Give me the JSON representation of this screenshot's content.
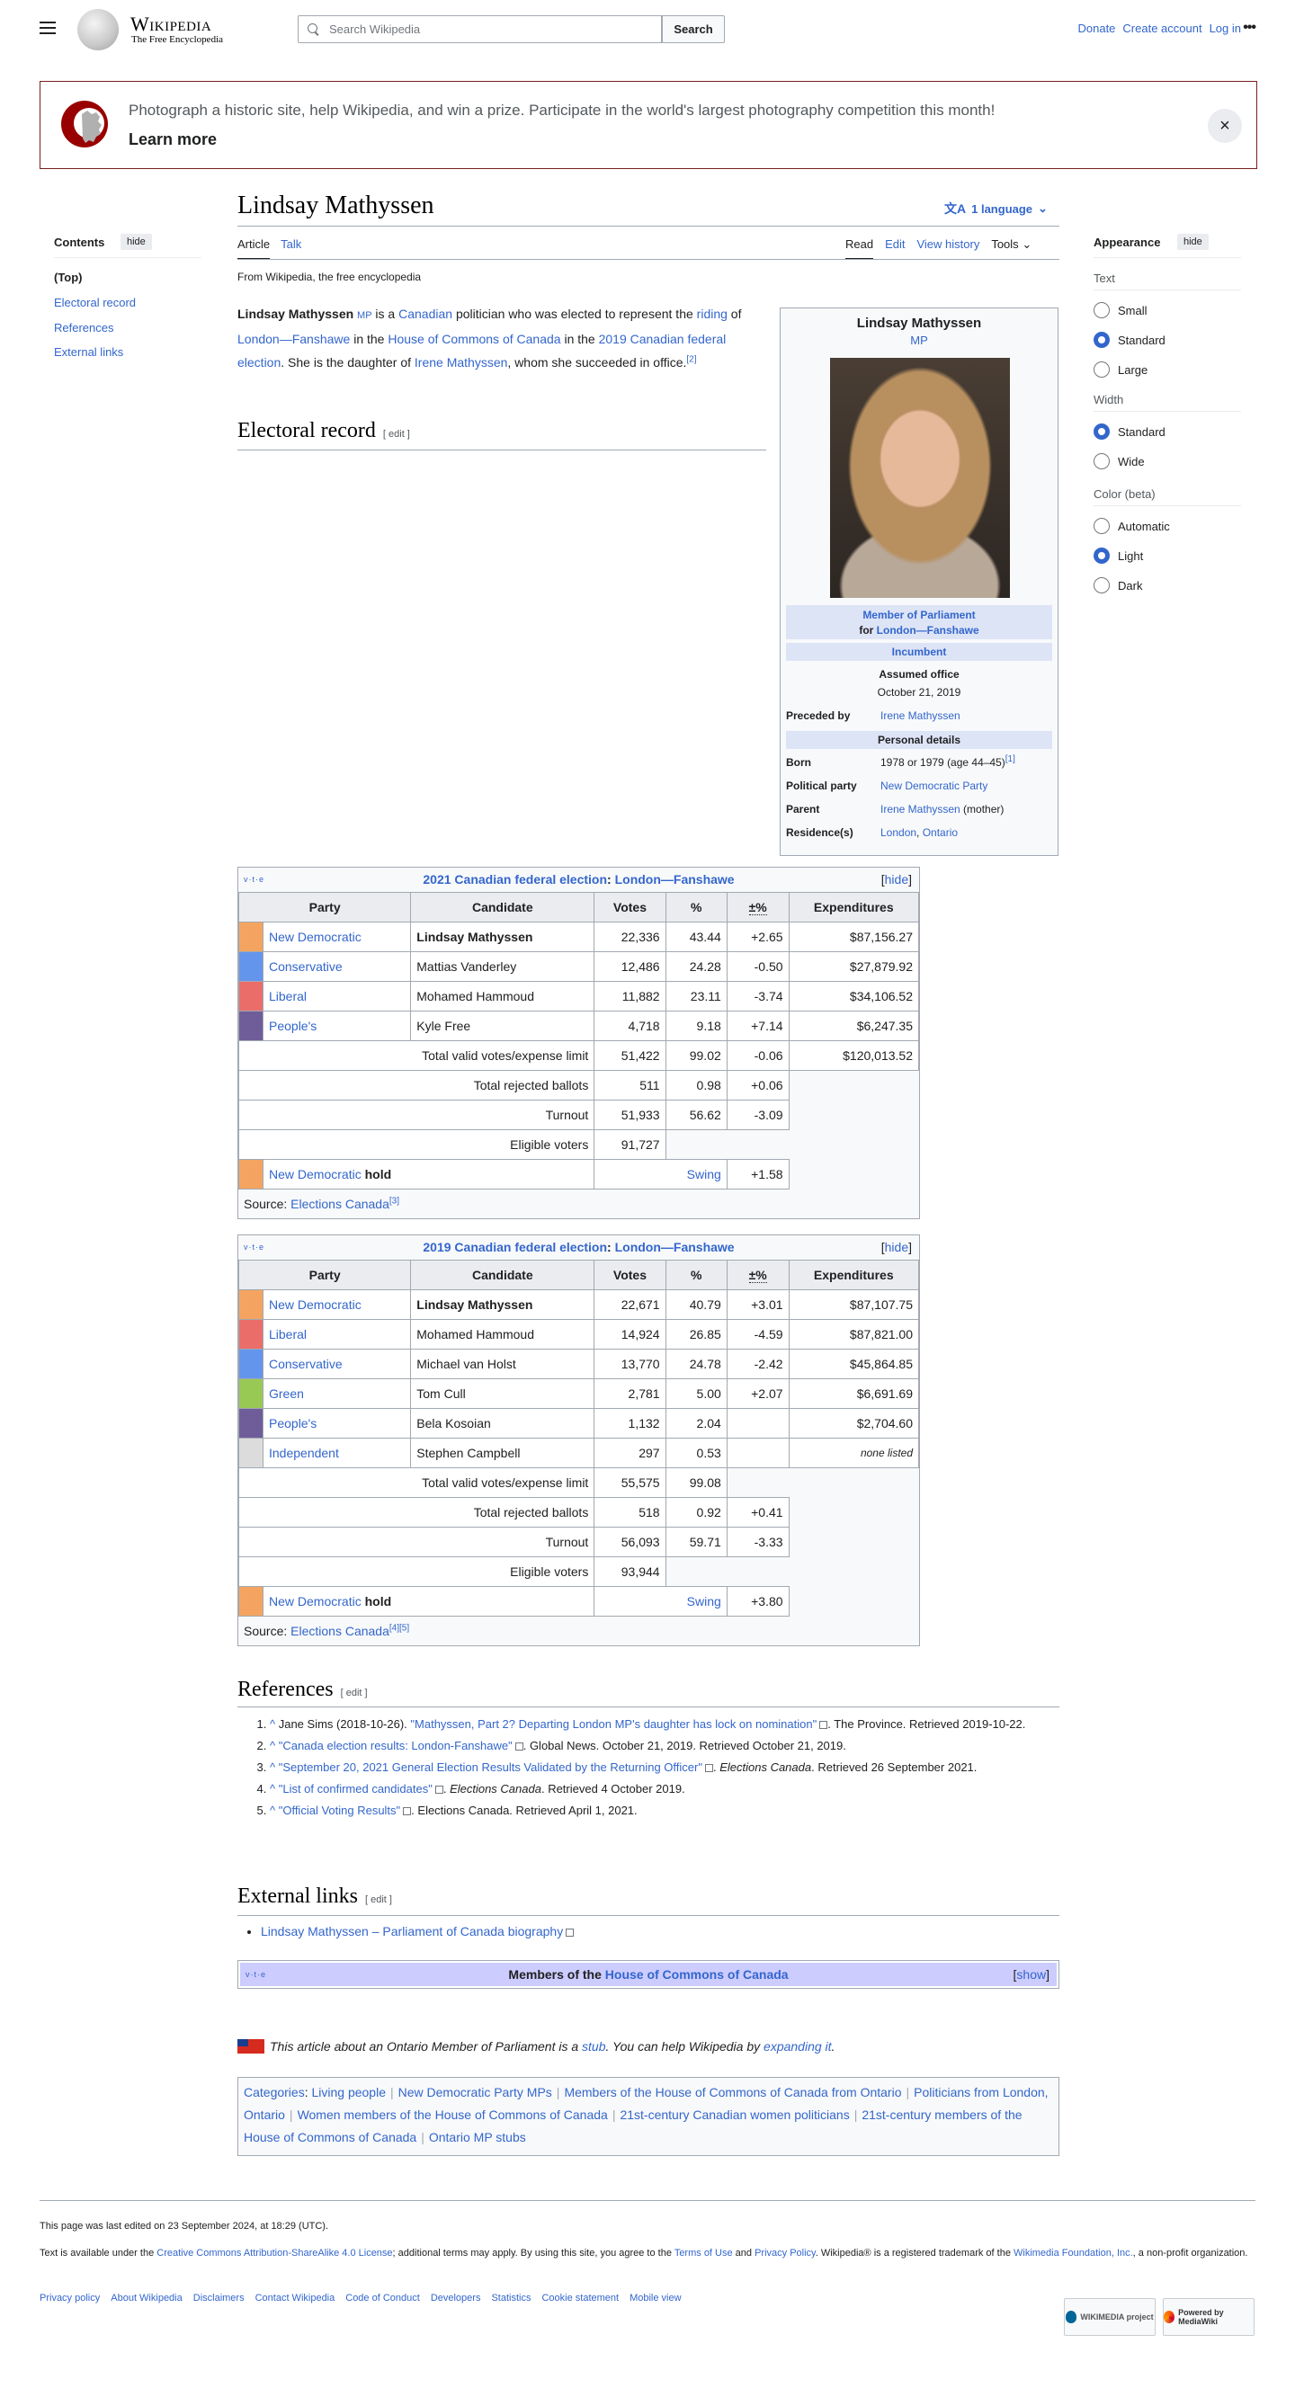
{
  "header": {
    "logo_word": "Wikipedia",
    "logo_tagline": "The Free Encyclopedia",
    "search_placeholder": "Search Wikipedia",
    "search_button": "Search",
    "links": [
      "Donate",
      "Create account",
      "Log in"
    ],
    "more": "•••"
  },
  "banner": {
    "text": "Photograph a historic site, help Wikipedia, and win a prize. Participate in the world's largest photography competition this month!",
    "learn_more": "Learn more",
    "close": "×"
  },
  "toc": {
    "title": "Contents",
    "hide": "hide",
    "items": [
      "(Top)",
      "Electoral record",
      "References",
      "External links"
    ]
  },
  "article": {
    "title": "Lindsay Mathyssen",
    "language_button": "1 language",
    "tabs_left": [
      "Article",
      "Talk"
    ],
    "tabs_right": [
      "Read",
      "Edit",
      "View history",
      "Tools"
    ],
    "from": "From Wikipedia, the free encyclopedia",
    "lead": {
      "name": "Lindsay Mathyssen",
      "mp": "MP",
      "t1": " is a ",
      "canadian": "Canadian",
      "t2": " politician who was elected to represent the ",
      "riding": "riding",
      "t3": " of ",
      "london_fanshawe": "London—Fanshawe",
      "t4": " in the ",
      "house": "House of Commons of Canada",
      "t5": " in the ",
      "election": "2019 Canadian federal election",
      "t6": ". She is the daughter of ",
      "irene": "Irene Mathyssen",
      "t7": ", whom she succeeded in office.",
      "cite": "[2]"
    },
    "electoral_heading": "Electoral record",
    "edit": "[ edit ]",
    "references_heading": "References",
    "external_heading": "External links"
  },
  "infobox": {
    "name": "Lindsay Mathyssen",
    "postnominal": "MP",
    "office_title": "Member of Parliament",
    "office_for": "for ",
    "office_riding": "London—Fanshawe",
    "status": "Incumbent",
    "assumed_label": "Assumed office",
    "assumed_date": "October 21, 2019",
    "preceded_label": "Preceded by",
    "preceded_value": "Irene Mathyssen",
    "personal_header": "Personal details",
    "born_label": "Born",
    "born_value": "1978 or 1979 (age 44–45)",
    "born_cite": "[1]",
    "party_label": "Political party",
    "party_value": "New Democratic Party",
    "parent_label": "Parent",
    "parent_value": "Irene Mathyssen",
    "parent_suffix": " (mother)",
    "residence_label": "Residence(s)",
    "residence_city": "London",
    "residence_province": "Ontario"
  },
  "election_tables": [
    {
      "vte": "v·t·e",
      "title_link": "2021 Canadian federal election",
      "title_sep": ": ",
      "title_riding": "London—Fanshawe",
      "hide": "hide",
      "headers": [
        "Party",
        "Candidate",
        "Votes",
        "%",
        "±%",
        "Expenditures"
      ],
      "rows": [
        {
          "color": "#f4a460",
          "party": "New Democratic",
          "candidate": "Lindsay Mathyssen",
          "bold": true,
          "votes": "22,336",
          "pct": "43.44",
          "change": "+2.65",
          "exp": "$87,156.27"
        },
        {
          "color": "#6495ed",
          "party": "Conservative",
          "candidate": "Mattias Vanderley",
          "bold": false,
          "votes": "12,486",
          "pct": "24.28",
          "change": "-0.50",
          "exp": "$27,879.92"
        },
        {
          "color": "#ea6d6a",
          "party": "Liberal",
          "candidate": "Mohamed Hammoud",
          "bold": false,
          "votes": "11,882",
          "pct": "23.11",
          "change": "-3.74",
          "exp": "$34,106.52"
        },
        {
          "color": "#6f5d9a",
          "party": "People's",
          "candidate": "Kyle Free",
          "bold": false,
          "votes": "4,718",
          "pct": "9.18",
          "change": "+7.14",
          "exp": "$6,247.35"
        }
      ],
      "totals": [
        {
          "label": "Total valid votes/expense limit",
          "votes": "51,422",
          "pct": "99.02",
          "change": "-0.06",
          "exp": "$120,013.52"
        },
        {
          "label": "Total rejected ballots",
          "votes": "511",
          "pct": "0.98",
          "change": "+0.06"
        },
        {
          "label": "Turnout",
          "votes": "51,933",
          "pct": "56.62",
          "change": "-3.09"
        },
        {
          "label": "Eligible voters",
          "votes": "91,727"
        }
      ],
      "hold": {
        "color": "#f4a460",
        "party": "New Democratic",
        "word": "hold",
        "swing_label": "Swing",
        "swing": "+1.58"
      },
      "source_label": "Source: ",
      "source_link": "Elections Canada",
      "source_cites": "[3]"
    },
    {
      "vte": "v·t·e",
      "title_link": "2019 Canadian federal election",
      "title_sep": ": ",
      "title_riding": "London—Fanshawe",
      "hide": "hide",
      "headers": [
        "Party",
        "Candidate",
        "Votes",
        "%",
        "±%",
        "Expenditures"
      ],
      "rows": [
        {
          "color": "#f4a460",
          "party": "New Democratic",
          "candidate": "Lindsay Mathyssen",
          "bold": true,
          "votes": "22,671",
          "pct": "40.79",
          "change": "+3.01",
          "exp": "$87,107.75"
        },
        {
          "color": "#ea6d6a",
          "party": "Liberal",
          "candidate": "Mohamed Hammoud",
          "bold": false,
          "votes": "14,924",
          "pct": "26.85",
          "change": "-4.59",
          "exp": "$87,821.00"
        },
        {
          "color": "#6495ed",
          "party": "Conservative",
          "candidate": "Michael van Holst",
          "bold": false,
          "votes": "13,770",
          "pct": "24.78",
          "change": "-2.42",
          "exp": "$45,864.85"
        },
        {
          "color": "#99c955",
          "party": "Green",
          "candidate": "Tom Cull",
          "bold": false,
          "votes": "2,781",
          "pct": "5.00",
          "change": "+2.07",
          "exp": "$6,691.69"
        },
        {
          "color": "#6f5d9a",
          "party": "People's",
          "candidate": "Bela Kosoian",
          "bold": false,
          "votes": "1,132",
          "pct": "2.04",
          "change": "",
          "exp": "$2,704.60"
        },
        {
          "color": "#dcdcdc",
          "party": "Independent",
          "candidate": "Stephen Campbell",
          "bold": false,
          "votes": "297",
          "pct": "0.53",
          "change": "",
          "exp": "none listed"
        }
      ],
      "totals": [
        {
          "label": "Total valid votes/expense limit",
          "votes": "55,575",
          "pct": "99.08"
        },
        {
          "label": "Total rejected ballots",
          "votes": "518",
          "pct": "0.92",
          "change": "+0.41"
        },
        {
          "label": "Turnout",
          "votes": "56,093",
          "pct": "59.71",
          "change": "-3.33"
        },
        {
          "label": "Eligible voters",
          "votes": "93,944"
        }
      ],
      "hold": {
        "color": "#f4a460",
        "party": "New Democratic",
        "word": "hold",
        "swing_label": "Swing",
        "swing": "+3.80"
      },
      "source_label": "Source: ",
      "source_link": "Elections Canada",
      "source_cites": "[4][5]"
    }
  ],
  "references": [
    {
      "pre": "Jane Sims (2018-10-26). ",
      "link": "\"Mathyssen, Part 2? Departing London MP's daughter has lock on nomination\"",
      "post": ". The Province. Retrieved 2019-10-22.",
      "italic": ""
    },
    {
      "pre": "",
      "link": "\"Canada election results: London-Fanshawe\"",
      "post": ". Global News. October 21, 2019. Retrieved October 21, 2019.",
      "italic": ""
    },
    {
      "pre": "",
      "link": "\"September 20, 2021 General Election Results Validated by the Returning Officer\"",
      "post": ". Retrieved 26 September 2021.",
      "italic": "Elections Canada"
    },
    {
      "pre": "",
      "link": "\"List of confirmed candidates\"",
      "post": ". Retrieved 4 October 2019.",
      "italic": "Elections Canada"
    },
    {
      "pre": "",
      "link": "\"Official Voting Results\"",
      "post": ". Elections Canada. Retrieved April 1, 2021.",
      "italic": ""
    }
  ],
  "external_links": [
    "Lindsay Mathyssen – Parliament of Canada biography"
  ],
  "navbox": {
    "vte": "v·t·e",
    "prefix": "Members of the ",
    "link": "House of Commons of Canada",
    "show": "show"
  },
  "stub": {
    "t1": "This article about an Ontario Member of Parliament is a ",
    "stub": "stub",
    "t2": ". You can help Wikipedia by ",
    "expand": "expanding it",
    "t3": "."
  },
  "categories": {
    "label": "Categories",
    "items": [
      "Living people",
      "New Democratic Party MPs",
      "Members of the House of Commons of Canada from Ontario",
      "Politicians from London, Ontario",
      "Women members of the House of Commons of Canada",
      "21st-century Canadian women politicians",
      "21st-century members of the House of Commons of Canada",
      "Ontario MP stubs"
    ]
  },
  "appearance": {
    "title": "Appearance",
    "hide": "hide",
    "text_label": "Text",
    "text_options": [
      {
        "label": "Small",
        "on": false
      },
      {
        "label": "Standard",
        "on": true
      },
      {
        "label": "Large",
        "on": false
      }
    ],
    "width_label": "Width",
    "width_options": [
      {
        "label": "Standard",
        "on": true
      },
      {
        "label": "Wide",
        "on": false
      }
    ],
    "color_label": "Color (beta)",
    "color_options": [
      {
        "label": "Automatic",
        "on": false
      },
      {
        "label": "Light",
        "on": true
      },
      {
        "label": "Dark",
        "on": false
      }
    ]
  },
  "footer": {
    "last_edited": "This page was last edited on 23 September 2024, at 18:29 (UTC).",
    "license_pre": "Text is available under the ",
    "license_link": "Creative Commons Attribution-ShareAlike 4.0 License",
    "license_mid": "; additional terms may apply. By using this site, you agree to the ",
    "terms_link": "Terms of Use",
    "and": " and ",
    "privacy_link": "Privacy Policy",
    "trademark": ". Wikipedia® is a registered trademark of the ",
    "foundation_link": "Wikimedia Foundation, Inc.",
    "nonprofit": ", a non-profit organization.",
    "links": [
      "Privacy policy",
      "About Wikipedia",
      "Disclaimers",
      "Contact Wikipedia",
      "Code of Conduct",
      "Developers",
      "Statistics",
      "Cookie statement",
      "Mobile view"
    ],
    "badge_wikimedia": "WIKIMEDIA project",
    "badge_mediawiki": "Powered by MediaWiki"
  }
}
